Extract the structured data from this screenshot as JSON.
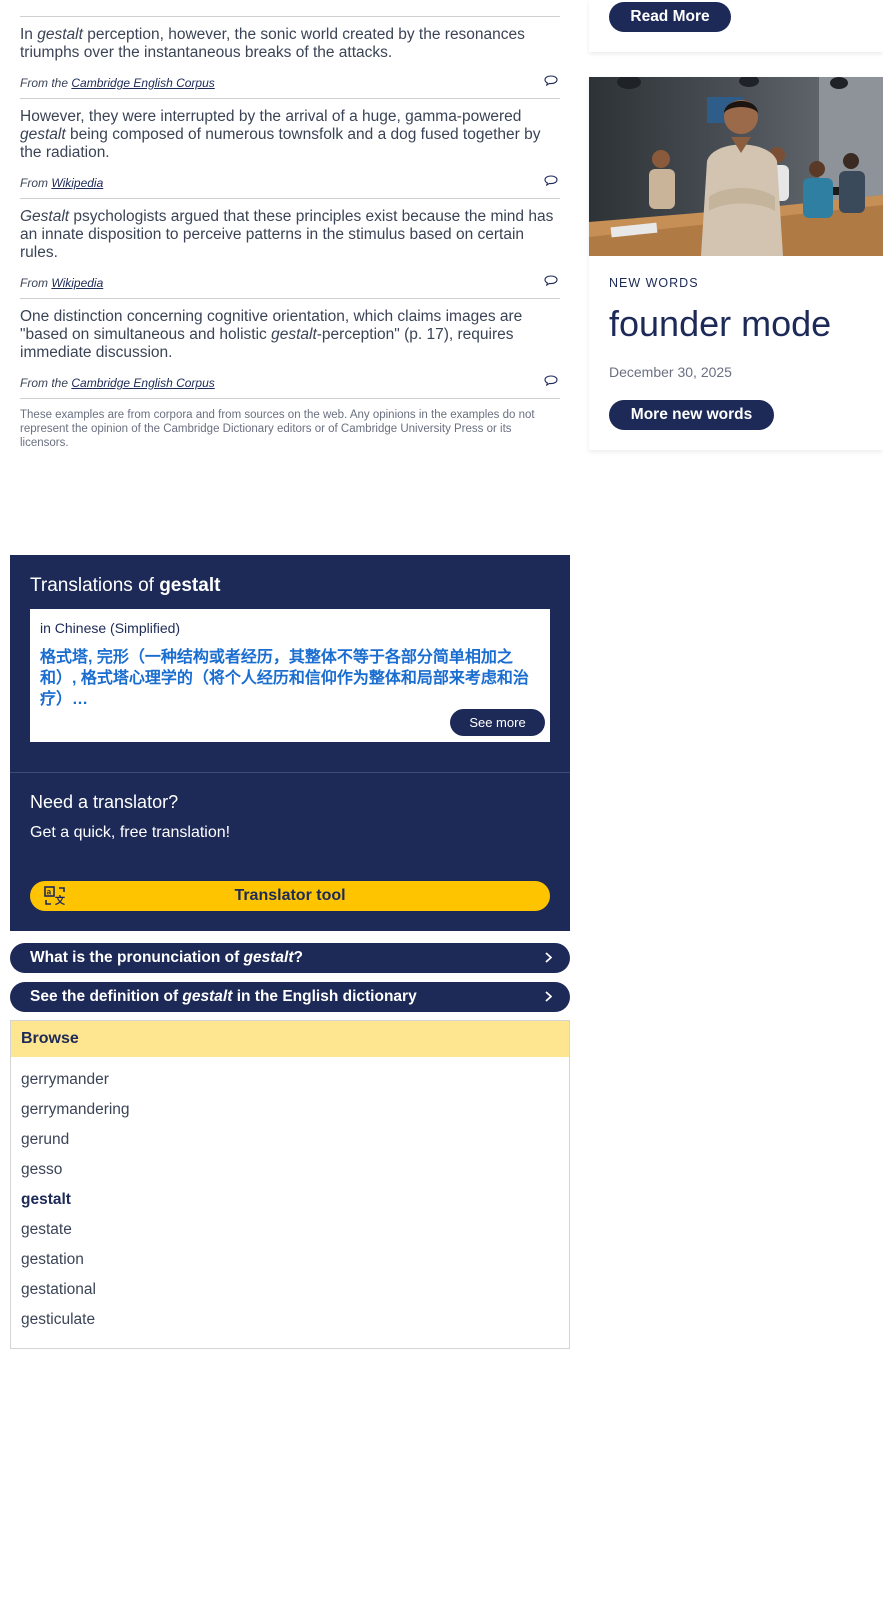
{
  "examples": [
    {
      "text_before": "In ",
      "keyword": "gestalt",
      "text_after": " perception, however, the sonic world created by the resonances triumphs over the instantaneous breaks of the attacks.",
      "source_prefix": "From the ",
      "source": "Cambridge English Corpus"
    },
    {
      "text_before": "However, they were interrupted by the arrival of a huge, gamma-powered ",
      "keyword": "gestalt",
      "text_after": " being composed of numerous townsfolk and a dog fused together by the radiation.",
      "source_prefix": "From ",
      "source": "Wikipedia"
    },
    {
      "text_before": "",
      "keyword": "Gestalt",
      "text_after": " psychologists argued that these principles exist because the mind has an innate disposition to perceive patterns in the stimulus based on certain rules.",
      "source_prefix": "From ",
      "source": "Wikipedia"
    },
    {
      "text_before": "One distinction concerning cognitive orientation, which claims images are \"based on simultaneous and holistic ",
      "keyword": "gestalt",
      "text_after": "-perception\" (p. 17), requires immediate discussion.",
      "source_prefix": "From the ",
      "source": "Cambridge English Corpus"
    }
  ],
  "disclaimer": "These examples are from corpora and from sources on the web. Any opinions in the examples do not represent the opinion of the Cambridge Dictionary editors or of Cambridge University Press or its licensors.",
  "translations": {
    "heading_prefix": "Translations of ",
    "word": "gestalt",
    "language": "in Chinese (Simplified)",
    "text": "格式塔, 完形（一种结构或者经历，其整体不等于各部分简单相加之和）, 格式塔心理学的（将个人经历和信仰作为整体和局部来考虑和治疗）…",
    "see_more": "See more",
    "need_translator": "Need a translator?",
    "quick_translation": "Get a quick, free translation!",
    "translator_tool": "Translator tool"
  },
  "links": {
    "pronunciation_prefix": "What is the pronunciation of ",
    "pronunciation_word": "gestalt",
    "pronunciation_suffix": "?",
    "definition_prefix": "See the definition of ",
    "definition_word": "gestalt",
    "definition_suffix": " in the English dictionary"
  },
  "browse": {
    "heading": "Browse",
    "items": [
      "gerrymander",
      "gerrymandering",
      "gerund",
      "gesso",
      "gestalt",
      "gestate",
      "gestation",
      "gestational",
      "gesticulate"
    ],
    "active_index": 4
  },
  "sidebar": {
    "read_more": "Read More",
    "new_words_label": "NEW WORDS",
    "new_word_title": "founder mode",
    "new_word_date": "December 30, 2025",
    "more_new_words": "More new words"
  },
  "colors": {
    "navy": "#1d2a57",
    "yellow": "#fec400",
    "browse_header": "#fee590",
    "link_blue": "#1a6dd0"
  }
}
